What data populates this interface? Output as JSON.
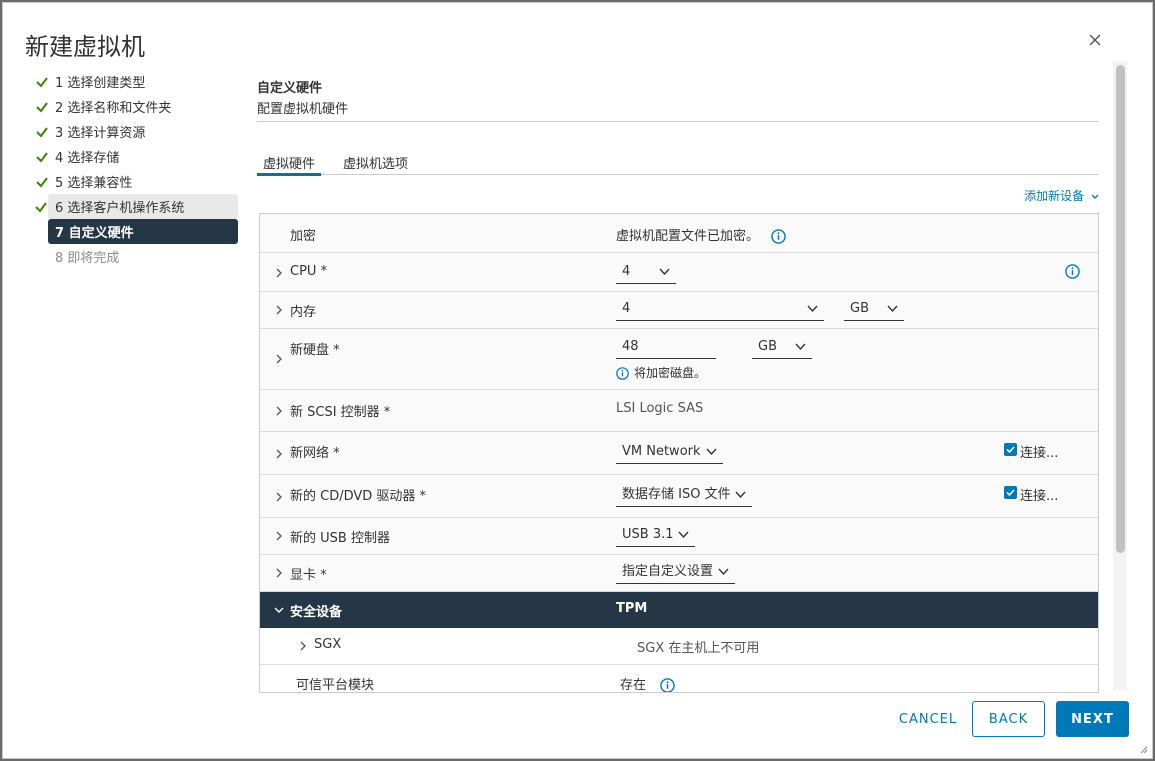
{
  "dialog": {
    "title": "新建虚拟机"
  },
  "steps": [
    {
      "label": "1 选择创建类型",
      "state": "done"
    },
    {
      "label": "2 选择名称和文件夹",
      "state": "done"
    },
    {
      "label": "3 选择计算资源",
      "state": "done"
    },
    {
      "label": "4 选择存储",
      "state": "done"
    },
    {
      "label": "5 选择兼容性",
      "state": "done"
    },
    {
      "label": "6 选择客户机操作系统",
      "state": "done"
    },
    {
      "label": "7 自定义硬件",
      "state": "active"
    },
    {
      "label": "8 即将完成",
      "state": "future"
    }
  ],
  "section": {
    "title": "自定义硬件",
    "subtitle": "配置虚拟机硬件"
  },
  "tabs": [
    {
      "label": "虚拟硬件"
    },
    {
      "label": "虚拟机选项"
    }
  ],
  "add_device": "添加新设备",
  "rows": {
    "encryption": {
      "label": "加密",
      "value": "虚拟机配置文件已加密。"
    },
    "cpu": {
      "label": "CPU *",
      "value": "4"
    },
    "memory": {
      "label": "内存",
      "value": "4",
      "unit": "GB"
    },
    "disk": {
      "label": "新硬盘 *",
      "value": "48",
      "unit": "GB",
      "note": "将加密磁盘。"
    },
    "scsi": {
      "label": "新 SCSI 控制器 *",
      "value": "LSI Logic SAS"
    },
    "network": {
      "label": "新网络 *",
      "value": "VM Network",
      "connect": "连接..."
    },
    "cddvd": {
      "label": "新的 CD/DVD 驱动器 *",
      "value": "数据存储 ISO 文件",
      "connect": "连接..."
    },
    "usb": {
      "label": "新的 USB 控制器",
      "value": "USB 3.1"
    },
    "video": {
      "label": "显卡 *",
      "value": "指定自定义设置"
    },
    "security": {
      "label": "安全设备",
      "value": "TPM"
    },
    "sgx": {
      "label": "SGX",
      "value": "SGX 在主机上不可用"
    },
    "tpm": {
      "label": "可信平台模块",
      "value": "存在"
    }
  },
  "buttons": {
    "cancel": "CANCEL",
    "back": "BACK",
    "next": "NEXT"
  },
  "colors": {
    "accent": "#0079b8",
    "dark": "#253746",
    "check": "#3c8500"
  }
}
